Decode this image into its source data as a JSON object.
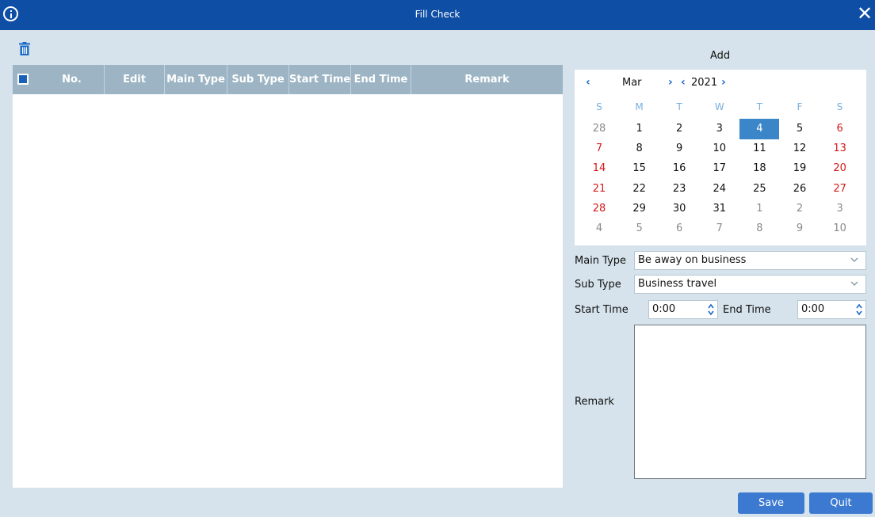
{
  "window": {
    "title": "Fill Check",
    "info_icon": "info-icon",
    "close_icon": "close-icon",
    "colors": {
      "titlebar": "#0e4ea5",
      "background": "#d6e3ec",
      "header": "#9cb4c3",
      "accent": "#3c7ad1",
      "weekend": "#d41a1a"
    }
  },
  "toolbar": {
    "delete_icon": "trash-icon"
  },
  "table": {
    "columns": [
      "No.",
      "Edit",
      "Main Type",
      "Sub Type",
      "Start Time",
      "End Time",
      "Remark"
    ],
    "rows": []
  },
  "form": {
    "heading": "Add",
    "calendar": {
      "month": "Mar",
      "year": "2021",
      "prev_month": "‹",
      "next_month": "›",
      "prev_year": "‹",
      "next_year": "›",
      "weekdays": [
        "S",
        "M",
        "T",
        "W",
        "T",
        "F",
        "S"
      ],
      "days": [
        "28",
        "1",
        "2",
        "3",
        "4",
        "5",
        "6",
        "7",
        "8",
        "9",
        "10",
        "11",
        "12",
        "13",
        "14",
        "15",
        "16",
        "17",
        "18",
        "19",
        "20",
        "21",
        "22",
        "23",
        "24",
        "25",
        "26",
        "27",
        "28",
        "29",
        "30",
        "31",
        "1",
        "2",
        "3",
        "4",
        "5",
        "6",
        "7",
        "8",
        "9",
        "10"
      ],
      "selected_day": "4"
    },
    "main_type_label": "Main Type",
    "main_type_value": "Be away on business",
    "sub_type_label": "Sub Type",
    "sub_type_value": "Business travel",
    "start_time_label": "Start Time",
    "start_time_value": "0:00",
    "end_time_label": "End Time",
    "end_time_value": "0:00",
    "remark_label": "Remark",
    "remark_value": ""
  },
  "buttons": {
    "save": "Save",
    "quit": "Quit"
  }
}
